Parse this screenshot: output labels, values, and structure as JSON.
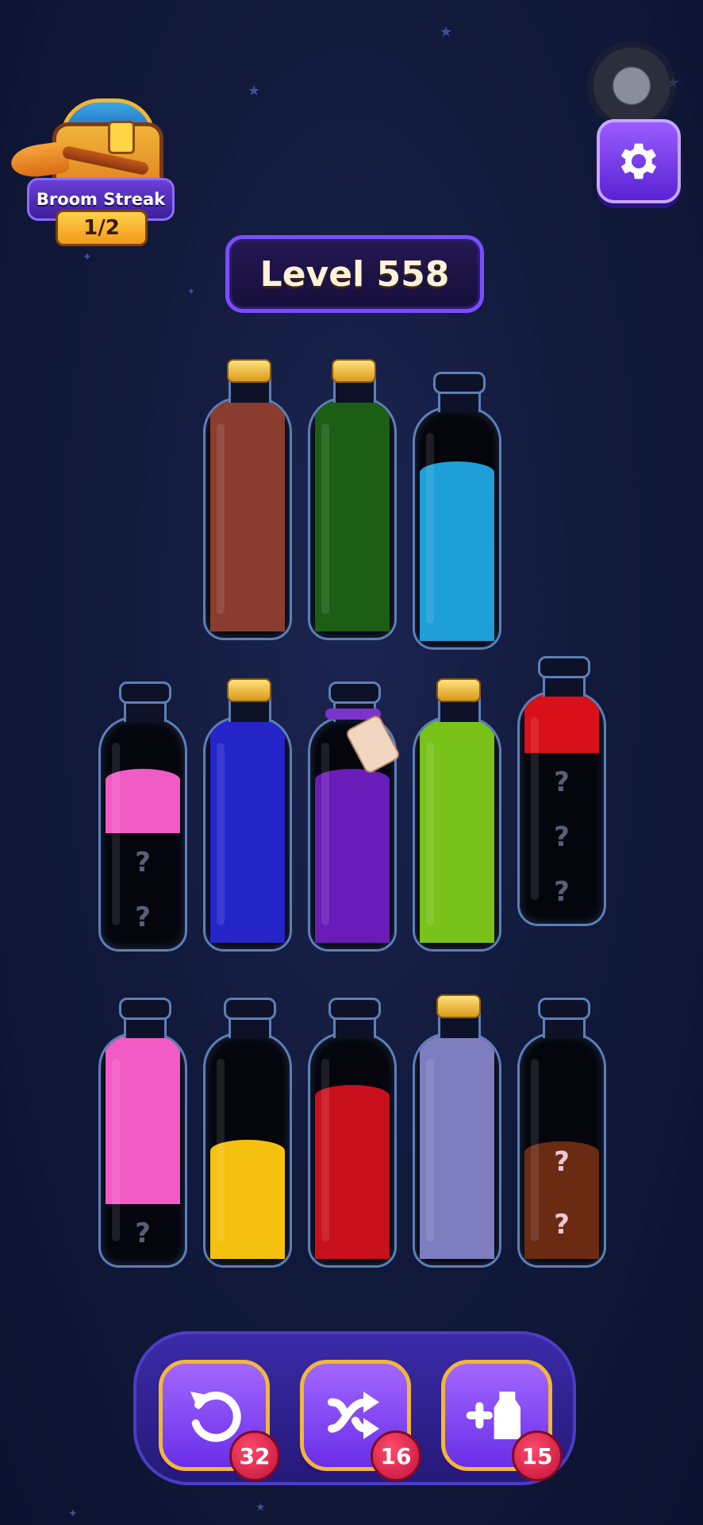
{
  "streak": {
    "label": "Broom Streak",
    "count": "1/2"
  },
  "level": {
    "title": "Level 558"
  },
  "bottles": {
    "row1": [
      {
        "cork": true,
        "layers": [
          "#8a3d2f",
          "#8a3d2f",
          "#8a3d2f",
          "#8a3d2f"
        ]
      },
      {
        "cork": true,
        "layers": [
          "#1c5e14",
          "#1c5e14",
          "#1c5e14",
          "#1c5e14"
        ]
      },
      {
        "cork": false,
        "layers": [
          "#1e9fd8",
          "#1e9fd8",
          "#1e9fd8"
        ]
      }
    ],
    "row2": [
      {
        "cork": false,
        "layers": [
          "unknown",
          "unknown",
          "#f15bc4"
        ]
      },
      {
        "cork": true,
        "layers": [
          "#2424c8",
          "#2424c8",
          "#2424c8",
          "#2424c8"
        ]
      },
      {
        "cork": false,
        "tag": true,
        "layers": [
          "#6a1cb8",
          "#6a1cb8",
          "#6a1cb8"
        ]
      },
      {
        "cork": true,
        "layers": [
          "#78c21a",
          "#78c21a",
          "#78c21a",
          "#78c21a"
        ]
      },
      {
        "cork": false,
        "layers": [
          "unknown",
          "unknown",
          "unknown",
          "#d8101a"
        ]
      }
    ],
    "row3": [
      {
        "cork": false,
        "layers": [
          "unknown",
          "#f15bc4",
          "#f15bc4",
          "#f15bc4"
        ]
      },
      {
        "cork": false,
        "layers": [
          "#f5c10e",
          "#f5c10e"
        ]
      },
      {
        "cork": false,
        "layers": [
          "#c8101c",
          "#c8101c",
          "#c8101c"
        ]
      },
      {
        "cork": true,
        "layers": [
          "#7d7dc0",
          "#7d7dc0",
          "#7d7dc0",
          "#7d7dc0"
        ]
      },
      {
        "cork": false,
        "layers": [
          "mystery",
          "mystery"
        ]
      }
    ]
  },
  "question_mark": "?",
  "tools": [
    {
      "icon": "undo-icon",
      "count": "32"
    },
    {
      "icon": "shuffle-icon",
      "count": "16"
    },
    {
      "icon": "add-bottle-icon",
      "count": "15"
    }
  ],
  "colors": {
    "accent": "#7b4dff",
    "gold": "#f2b73a",
    "badge": "#c0123a"
  }
}
